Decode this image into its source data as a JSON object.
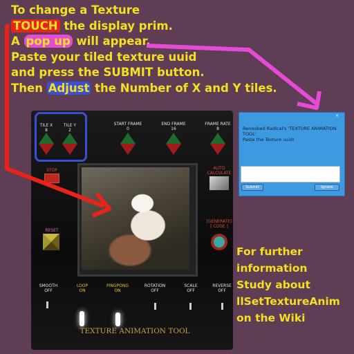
{
  "colors": {
    "background": "#5e3d55",
    "yellow_text": "#f2e021",
    "red_arrow": "#e8231a",
    "pink_arrow": "#e64bd6",
    "blue_highlight": "#3b4fd3",
    "dialog_blue": "#3d9ae0"
  },
  "instructions": {
    "line1": "To change a Texture",
    "line2_hl": "TOUCH",
    "line2_rest": " the display prim.",
    "line3_a": "A ",
    "line3_hl": "pop up",
    "line3_rest": " will appear.",
    "line4": "Paste your tiled texture uuid",
    "line5": "and press the SUBMIT button.",
    "line6_a": "Then ",
    "line6_hl": "Adjust",
    "line6_rest": " the Number of  X and Y tiles."
  },
  "tool": {
    "tile_x": {
      "label": "TILE X",
      "value": "8"
    },
    "tile_y": {
      "label": "TILE Y",
      "value": "2"
    },
    "start_frame": {
      "label": "START FRAME",
      "value": "0"
    },
    "end_frame": {
      "label": "END FRAME",
      "value": "16"
    },
    "frame_rate": {
      "label": "FRAME RATE",
      "value": "8"
    },
    "stop": "STOP",
    "auto_calc_1": "AUTO",
    "auto_calc_2": "CALCULATE",
    "reset": "RESET",
    "generate_1": "[GENERATE]",
    "generate_2": "[ CODE ]",
    "toggles": [
      {
        "name": "SMOOTH",
        "state": "OFF"
      },
      {
        "name": "LOOP",
        "state": "ON"
      },
      {
        "name": "PINGPONG",
        "state": "ON"
      },
      {
        "name": "ROTATION",
        "state": "OFF"
      },
      {
        "name": "SCALE",
        "state": "OFF"
      },
      {
        "name": "REVERSE",
        "state": "OFF"
      }
    ],
    "footer_title": "TEXTURE ANIMATION TOOL"
  },
  "dialog": {
    "message_1": "Renoobed Radical's 'TEXTURE ANIMATION",
    "message_2": "TOOL'",
    "message_3": " Paste the Texture uuid!",
    "submit_label": "Submit",
    "ignore_label": "Ignore"
  },
  "further": {
    "line1": "For further",
    "line2": "information",
    "line3": "Study  about",
    "line4": "llSetTextureAnim",
    "line5": "on the Wiki"
  }
}
